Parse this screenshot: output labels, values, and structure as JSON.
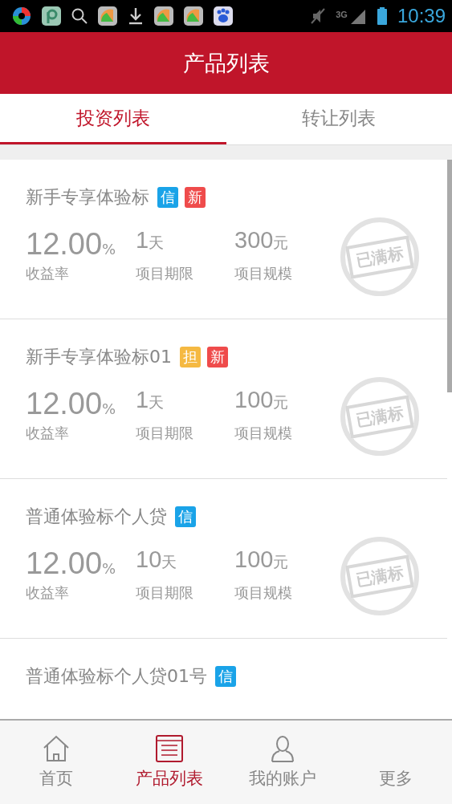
{
  "status_bar": {
    "network": "3G",
    "time": "10:39"
  },
  "header": {
    "title": "产品列表"
  },
  "tabs": [
    {
      "label": "投资列表",
      "selected": true
    },
    {
      "label": "转让列表",
      "selected": false
    }
  ],
  "products": [
    {
      "title": "新手专享体验标",
      "tags": [
        {
          "label": "信",
          "color": "#1aa3e8"
        },
        {
          "label": "新",
          "color": "#ef4b4b"
        }
      ],
      "rate": "12.00",
      "rate_unit": "%",
      "rate_label": "收益率",
      "term": "1",
      "term_unit": "天",
      "term_label": "项目期限",
      "size": "300",
      "size_unit": "元",
      "size_label": "项目规模",
      "stamp": "已满标"
    },
    {
      "title": "新手专享体验标01",
      "tags": [
        {
          "label": "担",
          "color": "#f5b942"
        },
        {
          "label": "新",
          "color": "#ef4b4b"
        }
      ],
      "rate": "12.00",
      "rate_unit": "%",
      "rate_label": "收益率",
      "term": "1",
      "term_unit": "天",
      "term_label": "项目期限",
      "size": "100",
      "size_unit": "元",
      "size_label": "项目规模",
      "stamp": "已满标"
    },
    {
      "title": "普通体验标个人贷",
      "tags": [
        {
          "label": "信",
          "color": "#1aa3e8"
        }
      ],
      "rate": "12.00",
      "rate_unit": "%",
      "rate_label": "收益率",
      "term": "10",
      "term_unit": "天",
      "term_label": "项目期限",
      "size": "100",
      "size_unit": "元",
      "size_label": "项目规模",
      "stamp": "已满标"
    },
    {
      "title": "普通体验标个人贷01号",
      "tags": [
        {
          "label": "信",
          "color": "#1aa3e8"
        }
      ]
    }
  ],
  "nav": [
    {
      "label": "首页",
      "selected": false
    },
    {
      "label": "产品列表",
      "selected": true
    },
    {
      "label": "我的账户",
      "selected": false
    },
    {
      "label": "更多",
      "selected": false
    }
  ]
}
